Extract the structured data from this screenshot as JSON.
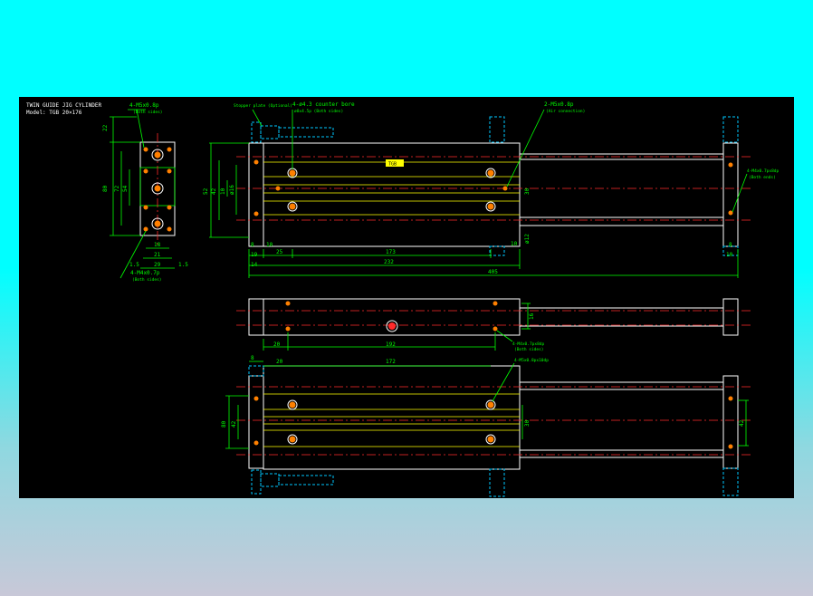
{
  "title_block": {
    "line1": "TWIN GUIDE JIG CYLINDER",
    "line2": "Model: TGB 20×176"
  },
  "nameplate": "TGB",
  "callouts": {
    "side_top": "4-M5x0.8p",
    "side_top_sub": "(Both sides)",
    "side_bottom": "4-M4x0.7p",
    "side_bottom_sub": "(Both sides)",
    "stopper": "Stopper plate (Optional)",
    "cb_hole": "4-ø4.3 counter bore",
    "cb_hole_sub": "ø8x4.5p (Both sides)",
    "port": "2-M5x0.8p",
    "port_sub": "(Air connection)",
    "rod_end": "4-M4x0.7px8dp",
    "rod_end_sub": "(Both ends)",
    "mid_right": "4-M4x0.7px8dp",
    "mid_right_sub": "(Both sides)",
    "bottom_right": "4-M5x0.8px10dp"
  },
  "dimensions": {
    "side_view": {
      "d22": "22",
      "d80": "80",
      "d72": "72",
      "d54": "54",
      "d18": "18",
      "d21": "21",
      "d29": "29",
      "d1_5a": "1.5",
      "d1_5b": "1.5"
    },
    "front_view": {
      "d42": "42",
      "d52": "52",
      "d10": "10",
      "d16": "ø16",
      "d8a": "8",
      "d14": "14",
      "d10b": "10",
      "d19": "19",
      "d25": "25",
      "d173": "173",
      "d10c": "10",
      "d232": "232",
      "d405": "405",
      "d30": "30",
      "d12": "ø12",
      "d8b": "8",
      "d10d": "10"
    },
    "middle_view": {
      "d20": "20",
      "d192": "192",
      "d16": "16"
    },
    "bottom_view": {
      "d8": "8",
      "d20": "20",
      "d172": "172",
      "d80": "80",
      "d42": "42",
      "d30": "30",
      "d42b": "42"
    }
  }
}
